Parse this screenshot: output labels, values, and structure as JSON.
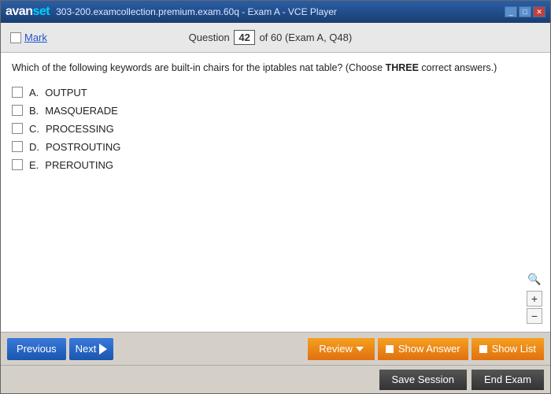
{
  "window": {
    "title": "303-200.examcollection.premium.exam.60q - Exam A - VCE Player",
    "controls": [
      "minimize",
      "maximize",
      "close"
    ]
  },
  "logo": {
    "part1": "avan",
    "part2": "set"
  },
  "question_header": {
    "mark_label": "Mark",
    "question_label": "Question",
    "question_number": "42",
    "total": "of 60 (Exam A, Q48)"
  },
  "question": {
    "text_before_bold": "Which of the following keywords are built-in chairs for the iptables nat table? (Choose ",
    "text_bold": "THREE",
    "text_after_bold": " correct answers.)",
    "options": [
      {
        "letter": "A.",
        "text": "OUTPUT"
      },
      {
        "letter": "B.",
        "text": "MASQUERADE"
      },
      {
        "letter": "C.",
        "text": "PROCESSING"
      },
      {
        "letter": "D.",
        "text": "POSTROUTING"
      },
      {
        "letter": "E.",
        "text": "PREROUTING"
      }
    ]
  },
  "nav": {
    "previous_label": "Previous",
    "next_label": "Next",
    "review_label": "Review",
    "show_answer_label": "Show Answer",
    "show_list_label": "Show List"
  },
  "bottom": {
    "save_label": "Save Session",
    "end_label": "End Exam"
  },
  "zoom": {
    "plus": "+",
    "minus": "−"
  }
}
